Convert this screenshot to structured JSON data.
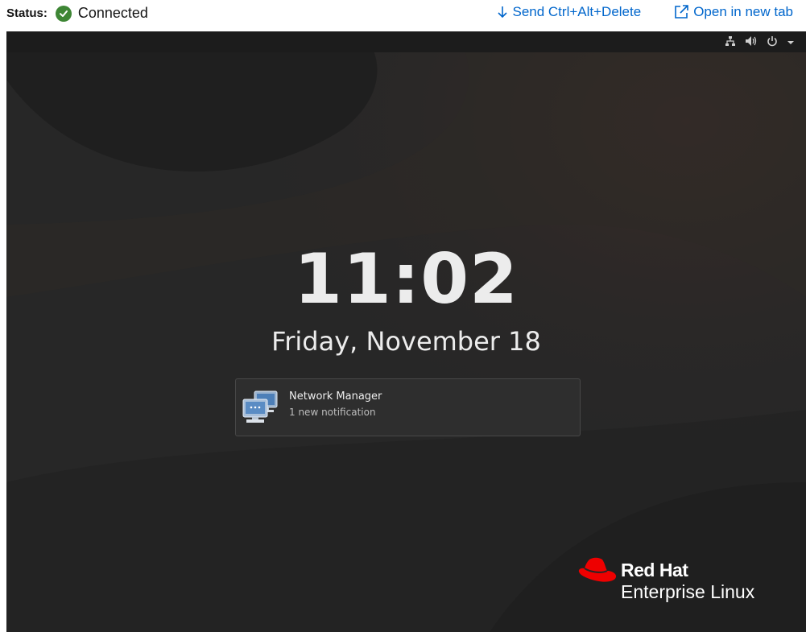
{
  "toolbar": {
    "status_label": "Status:",
    "status_value": "Connected",
    "status_icon": "check-circle-icon",
    "status_color": "#3e8635",
    "send_keys_label": "Send Ctrl+Alt+Delete",
    "send_keys_icon": "arrow-down-icon",
    "open_tab_label": "Open in new tab",
    "open_tab_icon": "external-link-icon",
    "link_color": "#0066cc"
  },
  "console": {
    "panel_icons": [
      "network-icon",
      "volume-icon",
      "power-icon",
      "chevron-down-icon"
    ],
    "lock_screen": {
      "time": "11:02",
      "date": "Friday, November 18"
    },
    "notification": {
      "icon": "network-computers-icon",
      "title": "Network Manager",
      "subtitle": "1 new notification"
    },
    "branding": {
      "logo_icon": "red-hat-logo-icon",
      "name": "Red Hat",
      "product": "Enterprise Linux",
      "logo_color": "#ee0000"
    }
  }
}
